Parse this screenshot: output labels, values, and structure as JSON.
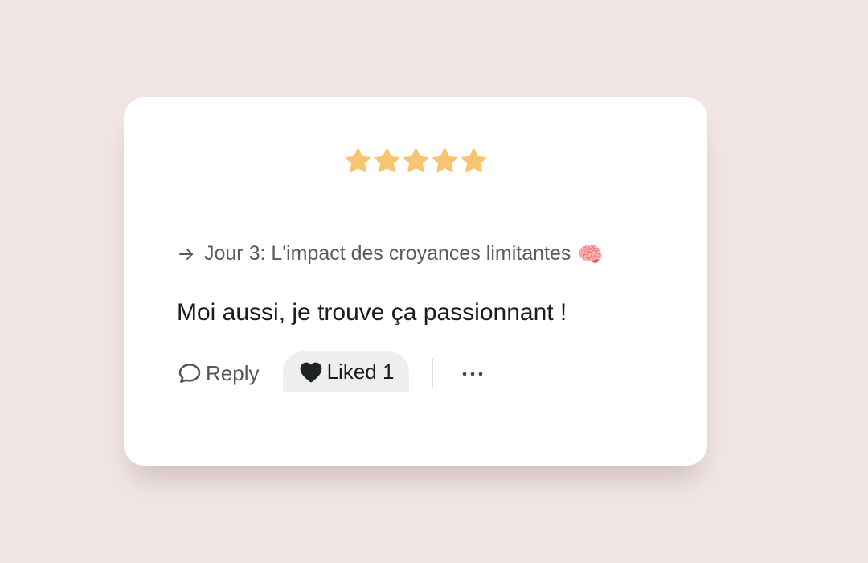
{
  "rating": {
    "value": 5,
    "max": 5,
    "star_color": "#f8c471"
  },
  "comment": {
    "context_icon": "arrow-right-icon",
    "context_text": "Jour 3: L'impact des croyances limitantes",
    "context_emoji": "🧠",
    "text": "Moi aussi, je trouve ça passionnant !"
  },
  "actions": {
    "reply_icon": "speech-bubble-icon",
    "reply_label": "Reply",
    "like_icon": "heart-icon",
    "liked_label": "Liked 1",
    "liked_bg": "#efefef",
    "more_icon": "more-horizontal-icon"
  },
  "colors": {
    "page_bg": "#f2e6e5",
    "card_bg": "#ffffff",
    "text_primary": "#1c1c1c",
    "text_secondary": "#5b5b5b"
  }
}
